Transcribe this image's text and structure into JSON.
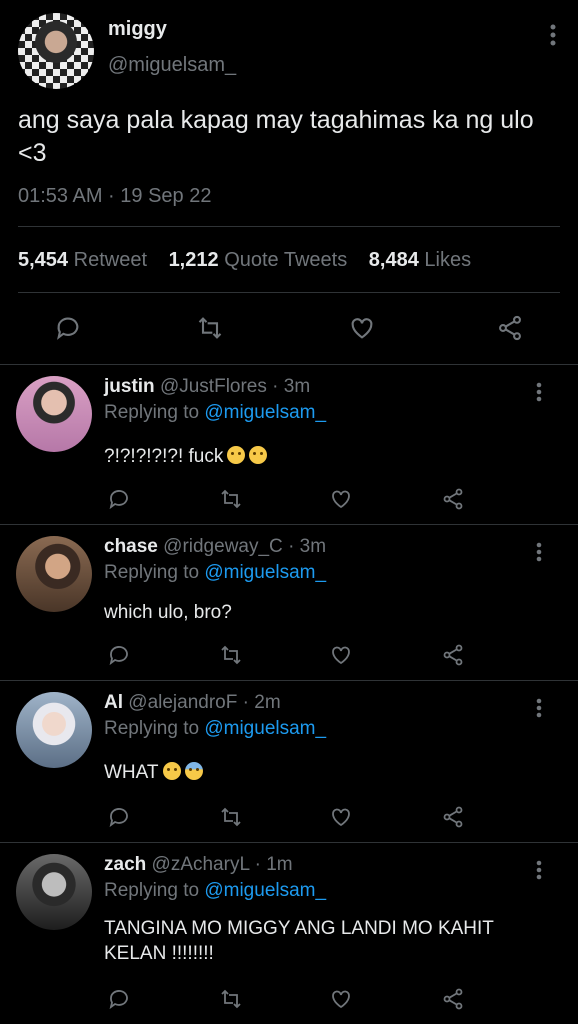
{
  "tweet": {
    "name": "miggy",
    "handle": "@miguelsam_",
    "text": "ang saya pala kapag may tagahimas ka ng ulo <3",
    "time": "01:53 AM · 19 Sep 22",
    "retweets_count": "5,454",
    "retweets_label": "Retweet",
    "quotes_count": "1,212",
    "quotes_label": "Quote Tweets",
    "likes_count": "8,484",
    "likes_label": "Likes"
  },
  "replies": [
    {
      "name": "justin",
      "handle": "@JustFlores",
      "time": "· 3m",
      "replying_label": "Replying to",
      "replying_to": "@miguelsam_",
      "text": "?!?!?!?!?! fuck"
    },
    {
      "name": "chase",
      "handle": "@ridgeway_C",
      "time": "· 3m",
      "replying_label": "Replying to",
      "replying_to": "@miguelsam_",
      "text": "which ulo, bro?"
    },
    {
      "name": "Al",
      "handle": "@alejandroF",
      "time": "· 2m",
      "replying_label": "Replying to",
      "replying_to": "@miguelsam_",
      "text": "WHAT"
    },
    {
      "name": "zach",
      "handle": "@zAcharyL",
      "time": "· 1m",
      "replying_label": "Replying to",
      "replying_to": "@miguelsam_",
      "text": "TANGINA MO MIGGY ANG LANDI MO KAHIT KELAN !!!!!!!!"
    }
  ],
  "icons": [
    "reply-icon",
    "retweet-icon",
    "like-icon",
    "share-icon",
    "more-icon"
  ],
  "colors": {
    "background": "#000000",
    "text": "#e7e9ea",
    "secondary": "#71767b",
    "link": "#1d9bf0",
    "divider": "#2f3336"
  }
}
